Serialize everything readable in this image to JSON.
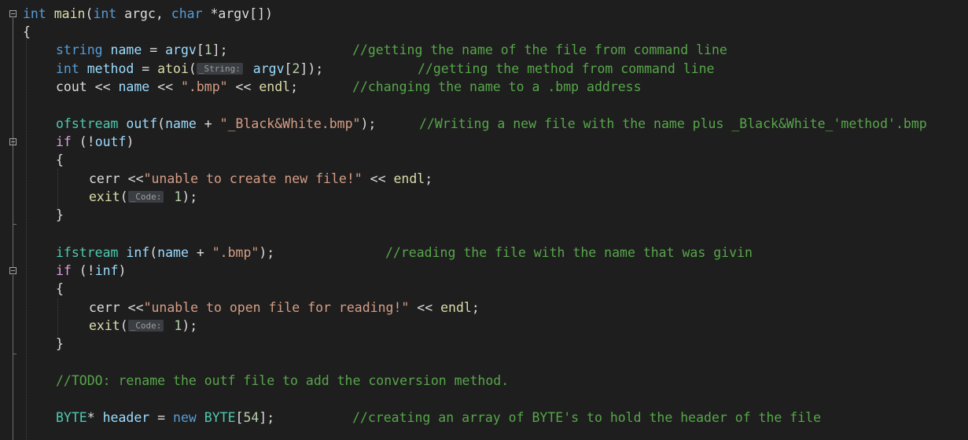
{
  "code_lines": [
    {
      "id": "main-decl",
      "tokens": [
        "int",
        " ",
        "main",
        "(",
        "int",
        " argc, ",
        "char",
        " *argv[])"
      ]
    },
    {
      "id": "brace-open",
      "tokens": [
        "{"
      ]
    },
    {
      "id": "name-line",
      "tokens": [
        "string",
        " ",
        "name",
        " = ",
        "argv",
        "[",
        "1",
        "];",
        "//getting the name of the file from command line"
      ]
    },
    {
      "id": "method-line",
      "tokens": [
        "int",
        " ",
        "method",
        " = ",
        "atoi",
        "(",
        "_String:",
        " ",
        "argv",
        "[",
        "2",
        "]);",
        "//getting the method from command line"
      ]
    },
    {
      "id": "cout-line",
      "tokens": [
        "cout",
        " << ",
        "name",
        " << ",
        "\".bmp\"",
        " << ",
        "endl",
        ";",
        "//changing the name to a .bmp address"
      ]
    },
    {
      "id": "ofstream-line",
      "tokens": [
        "ofstream",
        " ",
        "outf",
        "(",
        "name",
        " + ",
        "\"_Black&White.bmp\"",
        ");",
        "//Writing a new file with the name plus _Black&White_'method'.bmp"
      ]
    },
    {
      "id": "if-outf",
      "tokens": [
        "if",
        " (!",
        "outf",
        ")"
      ]
    },
    {
      "id": "brace-2",
      "tokens": [
        "{"
      ]
    },
    {
      "id": "cerr-1",
      "tokens": [
        "cerr",
        " <<",
        "\"unable to create new file!\"",
        " << ",
        "endl",
        ";"
      ]
    },
    {
      "id": "exit-1",
      "tokens": [
        "exit",
        "(",
        "_Code:",
        " ",
        "1",
        ");"
      ]
    },
    {
      "id": "brace-3",
      "tokens": [
        "}"
      ]
    },
    {
      "id": "ifstream-line",
      "tokens": [
        "ifstream",
        " ",
        "inf",
        "(",
        "name",
        " + ",
        "\".bmp\"",
        ");",
        "//reading the file with the name that was givin"
      ]
    },
    {
      "id": "if-inf",
      "tokens": [
        "if",
        " (!",
        "inf",
        ")"
      ]
    },
    {
      "id": "brace-4",
      "tokens": [
        "{"
      ]
    },
    {
      "id": "cerr-2",
      "tokens": [
        "cerr",
        " <<",
        "\"unable to open file for reading!\"",
        " << ",
        "endl",
        ";"
      ]
    },
    {
      "id": "exit-2",
      "tokens": [
        "exit",
        "(",
        "_Code:",
        " ",
        "1",
        ");"
      ]
    },
    {
      "id": "brace-5",
      "tokens": [
        "}"
      ]
    },
    {
      "id": "todo-line",
      "tokens": [
        "//TODO: rename the outf file to add the conversion method."
      ]
    },
    {
      "id": "header-line",
      "tokens": [
        "BYTE",
        "* ",
        "header",
        " = ",
        "new",
        " ",
        "BYTE",
        "[",
        "54",
        "];",
        "//creating an array of BYTE's to hold the header of the file"
      ]
    }
  ],
  "colors": {
    "background": "#1e1e1e",
    "keyword": "#569cd6",
    "type": "#4ec9b0",
    "function": "#dcdcaa",
    "variable": "#9cdcfe",
    "string": "#d69d85",
    "number": "#b5cea8",
    "comment": "#57a64a",
    "control": "#d8a0df"
  },
  "fold_icons": [
    "minus-box",
    "minus-box",
    "minus-box"
  ]
}
